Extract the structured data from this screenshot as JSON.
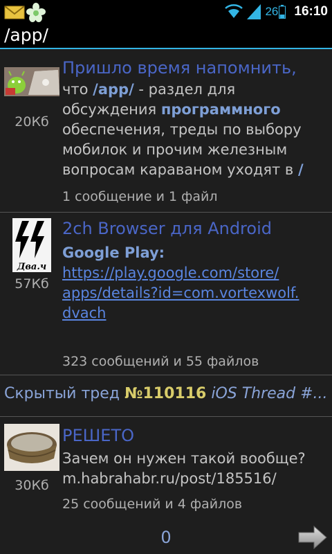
{
  "status_bar": {
    "battery_level": "26",
    "time": "16:10",
    "accent": "#33b5e5"
  },
  "title_bar": {
    "title": "/app/"
  },
  "posts": [
    {
      "subject": "Пришло время напомнить,",
      "body_parts": [
        "что ",
        "/app/",
        " - раздел для обсуждения ",
        "программного",
        " обеспечения, треды по выбору мобилок и прочим железным вопросам караваном уходят в ",
        "/"
      ],
      "size": "20Кб",
      "counts": "1 сообщение и 1 файл"
    },
    {
      "subject": "2ch Browser для Android",
      "body_label": "Google Play:",
      "body_link": "https://play.google.com/store/apps/details?id=com.vortexwolf.dvach",
      "link_lines": [
        "https://play.google.com/store/",
        "apps/details?id=com.vortexwolf.",
        "dvach"
      ],
      "size": "57Кб",
      "counts": "323 сообщений и 55 файлов"
    },
    {
      "subject": "РЕШЕТО",
      "body_lines": [
        "Зачем он нужен такой вообще?",
        "m.habrahabr.ru/post/185516/"
      ],
      "size": "30Кб",
      "counts": "25 сообщений и 4 файлов"
    }
  ],
  "hidden_thread": {
    "label": "Скрытый тред",
    "number": "№110116",
    "title": "iOS Thread #..."
  },
  "pagination": {
    "page": "0"
  },
  "colors": {
    "subject": "#4a66c7",
    "link": "#5a85e0",
    "number": "#d8cc6a",
    "divider": "#555555"
  }
}
